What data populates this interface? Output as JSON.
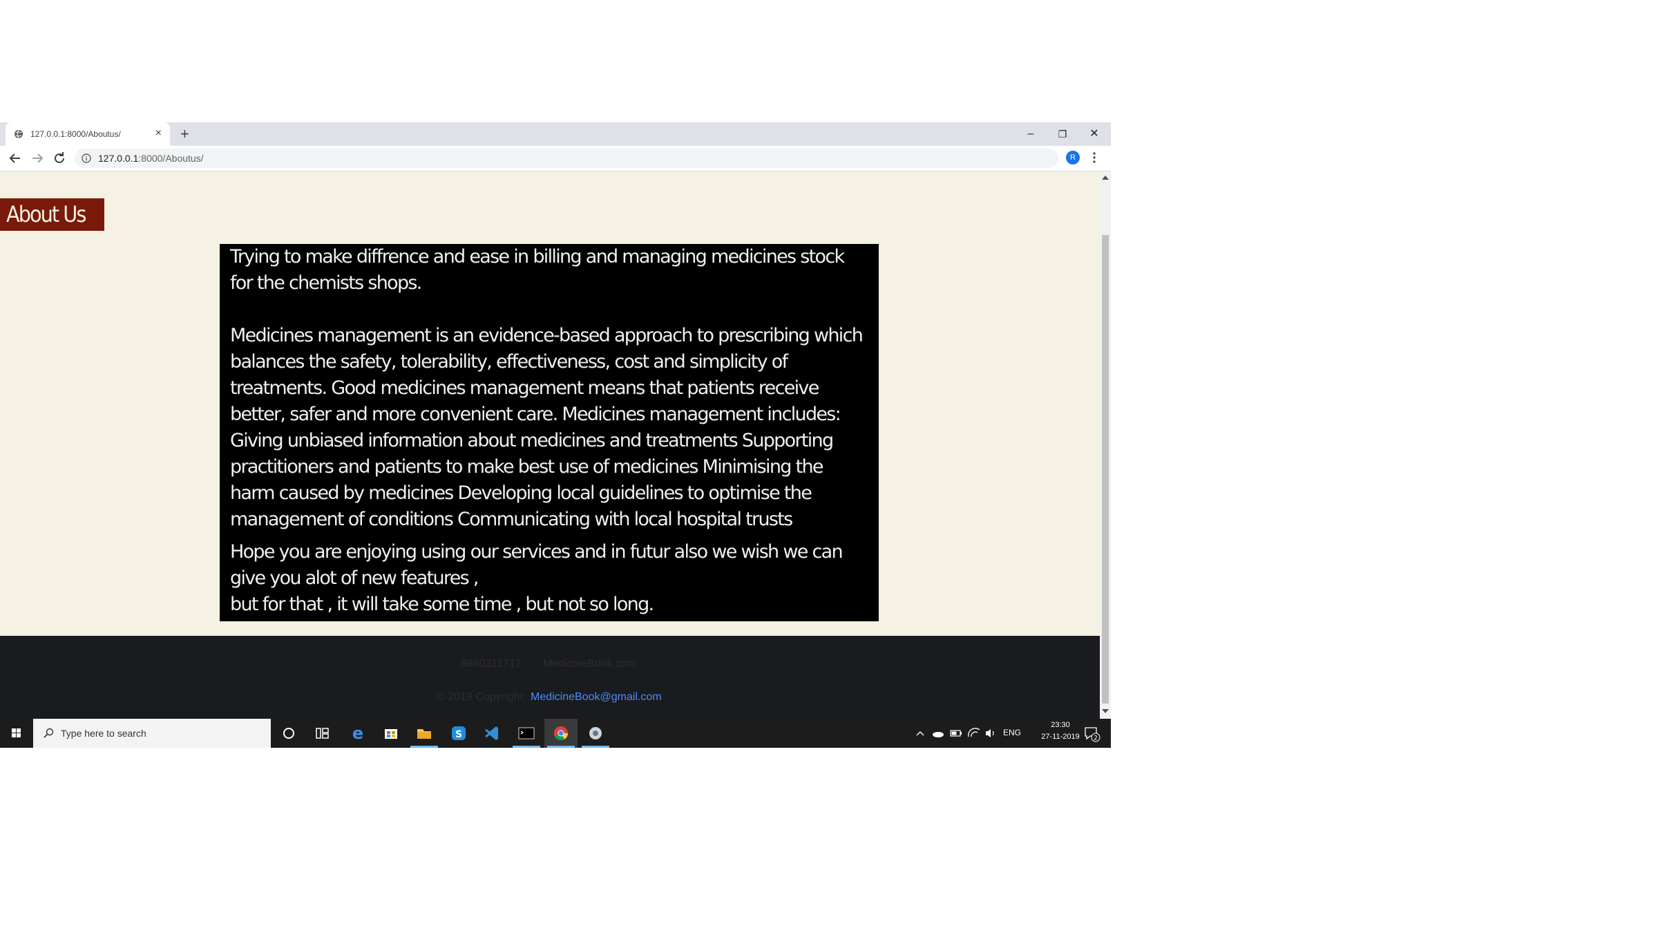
{
  "browser": {
    "tab_title": "127.0.0.1:8000/Aboutus/",
    "tab_close": "×",
    "new_tab": "+",
    "url_host": "127.0.0.1",
    "url_path": ":8000/Aboutus/",
    "profile_initial": "R",
    "window_controls": {
      "minimize": "–",
      "restore": "❐",
      "close": "✕"
    }
  },
  "page": {
    "heading": "About Us",
    "paragraphs": [
      "Trying to make diffrence and ease in billing and managing medicines stock for the chemists shops.",
      "Medicines management is an evidence-based approach to prescribing which balances the safety, tolerability, effectiveness, cost and simplicity of treatments. Good medicines management means that patients receive better, safer and more convenient care. Medicines management includes: Giving unbiased information about medicines and treatments Supporting practitioners and patients to make best use of medicines Minimising the harm caused by medicines Developing local guidelines to optimise the management of conditions Communicating with local hospital trusts",
      "Hope you are enjoying using our services and in futur also we wish we can give you alot of new features ,",
      "but for that , it will take some time , but not so long."
    ],
    "footer": {
      "phone": "9860311717",
      "site": "MedicineBook.com",
      "copyright": "© 2019 Copyright:",
      "email": "MedicineBook@gmail.com"
    }
  },
  "taskbar": {
    "search_placeholder": "Type here to search",
    "language": "ENG",
    "time": "23:30",
    "date": "27-11-2019",
    "notification_count": "2"
  }
}
